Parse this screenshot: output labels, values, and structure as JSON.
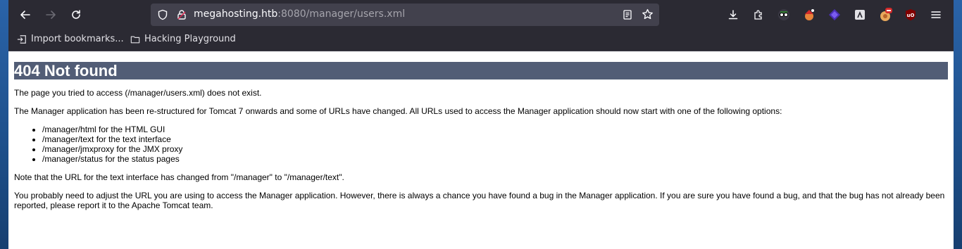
{
  "toolbar": {
    "url_host": "megahosting.htb",
    "url_path": ":8080/manager/users.xml"
  },
  "bookmarks": [
    {
      "label": "Import bookmarks..."
    },
    {
      "label": "Hacking Playground"
    }
  ],
  "page": {
    "title": "404 Not found",
    "intro": "The page you tried to access (/manager/users.xml) does not exist.",
    "restructured": "The Manager application has been re-structured for Tomcat 7 onwards and some of URLs have changed. All URLs used to access the Manager application should now start with one of the following options:",
    "options": [
      "/manager/html for the HTML GUI",
      "/manager/text for the text interface",
      "/manager/jmxproxy for the JMX proxy",
      "/manager/status for the status pages"
    ],
    "note": "Note that the URL for the text interface has changed from \"/manager\" to \"/manager/text\".",
    "adjust": "You probably need to adjust the URL you are using to access the Manager application. However, there is always a chance you have found a bug in the Manager application. If you are sure you have found a bug, and that the bug has not already been reported, please report it to the Apache Tomcat team."
  },
  "colors": {
    "heading_bg": "#525d76",
    "toolbar_bg": "#2b2a33",
    "urlbar_bg": "#42414d"
  },
  "icons": [
    "back-arrow-icon",
    "forward-arrow-icon",
    "reload-icon",
    "shield-icon",
    "lock-icon",
    "reader-view-icon",
    "bookmark-star-icon",
    "download-icon",
    "extensions-icon",
    "extension-icon",
    "menu-icon",
    "import-icon",
    "folder-icon"
  ]
}
